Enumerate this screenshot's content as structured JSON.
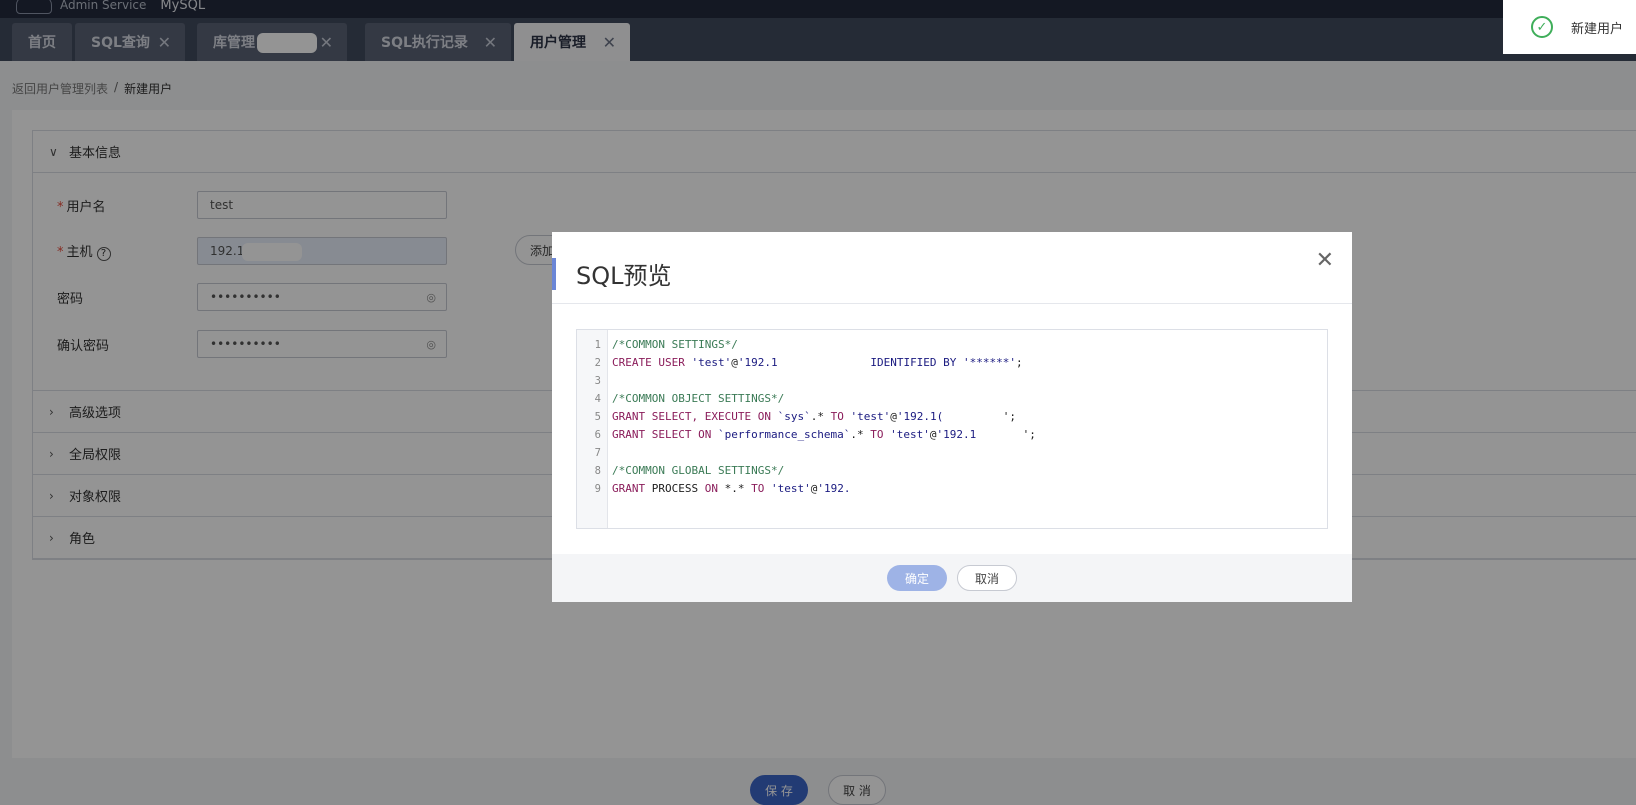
{
  "header": {
    "app_name": "Admin Service",
    "db_type": "MySQL"
  },
  "tabs": [
    {
      "label": "首页",
      "closable": false,
      "active": false
    },
    {
      "label": "SQL查询",
      "closable": true,
      "active": false
    },
    {
      "label": "库管理",
      "closable": true,
      "active": false
    },
    {
      "label": "SQL执行记录",
      "closable": true,
      "active": false
    },
    {
      "label": "用户管理",
      "closable": true,
      "active": true
    }
  ],
  "tab_close_glyph": "✕",
  "breadcrumb": {
    "back": "返回用户管理列表",
    "separator": "/",
    "current": "新建用户"
  },
  "basic": {
    "title": "基本信息",
    "username_label": "用户名",
    "username_value": "test",
    "host_label": "主机",
    "host_value": "192.16",
    "password_label": "密码",
    "password_value": "••••••••••",
    "confirm_label": "确认密码",
    "confirm_value": "••••••••••",
    "add_label": "添加"
  },
  "sections": [
    "高级选项",
    "全局权限",
    "对象权限",
    "角色"
  ],
  "footer": {
    "save": "保 存",
    "cancel": "取 消"
  },
  "toast": {
    "text": "新建用户"
  },
  "modal": {
    "title": "SQL预览",
    "ok": "确定",
    "cancel": "取消",
    "line_numbers": [
      "1",
      "2",
      "3",
      "4",
      "5",
      "6",
      "7",
      "8",
      "9"
    ],
    "lines": [
      [
        {
          "t": "/*COMMON SETTINGS*/",
          "c": "comment"
        }
      ],
      [
        {
          "t": "CREATE USER ",
          "c": "kw"
        },
        {
          "t": "'test'",
          "c": "str"
        },
        {
          "t": "@",
          "c": "plain"
        },
        {
          "t": "'192.1",
          "c": "str"
        },
        {
          "t": "              ",
          "c": "plain"
        },
        {
          "t": "IDENTIFIED BY ",
          "c": "str"
        },
        {
          "t": "'******'",
          "c": "str"
        },
        {
          "t": ";",
          "c": "plain"
        }
      ],
      [],
      [
        {
          "t": "/*COMMON OBJECT SETTINGS*/",
          "c": "comment"
        }
      ],
      [
        {
          "t": "GRANT SELECT, EXECUTE ON ",
          "c": "kw"
        },
        {
          "t": "`sys`",
          "c": "str"
        },
        {
          "t": ".* ",
          "c": "plain"
        },
        {
          "t": "TO ",
          "c": "kw"
        },
        {
          "t": "'test'",
          "c": "str"
        },
        {
          "t": "@",
          "c": "plain"
        },
        {
          "t": "'192.1(",
          "c": "str"
        },
        {
          "t": "         ",
          "c": "plain"
        },
        {
          "t": "';",
          "c": "plain"
        }
      ],
      [
        {
          "t": "GRANT SELECT ON ",
          "c": "kw"
        },
        {
          "t": "`performance_schema`",
          "c": "str"
        },
        {
          "t": ".* ",
          "c": "plain"
        },
        {
          "t": "TO ",
          "c": "kw"
        },
        {
          "t": "'test'",
          "c": "str"
        },
        {
          "t": "@",
          "c": "plain"
        },
        {
          "t": "'192.1",
          "c": "str"
        },
        {
          "t": "       ",
          "c": "plain"
        },
        {
          "t": "';",
          "c": "plain"
        }
      ],
      [],
      [
        {
          "t": "/*COMMON GLOBAL SETTINGS*/",
          "c": "comment"
        }
      ],
      [
        {
          "t": "GRANT ",
          "c": "kw"
        },
        {
          "t": "PROCESS ",
          "c": "plain"
        },
        {
          "t": "ON ",
          "c": "kw"
        },
        {
          "t": "*.* ",
          "c": "plain"
        },
        {
          "t": "TO ",
          "c": "kw"
        },
        {
          "t": "'test'",
          "c": "str"
        },
        {
          "t": "@",
          "c": "plain"
        },
        {
          "t": "'192.",
          "c": "str"
        }
      ]
    ]
  },
  "colors": {
    "accent": "#3c66c9",
    "success": "#3fae5a",
    "header": "#232a3d",
    "tabbar": "#414a5e"
  },
  "icons": {
    "toast": "check-circle-icon",
    "close": "close-icon",
    "chevron": "chevron-icon",
    "eye": "eye-hidden-icon",
    "help": "help-icon"
  }
}
